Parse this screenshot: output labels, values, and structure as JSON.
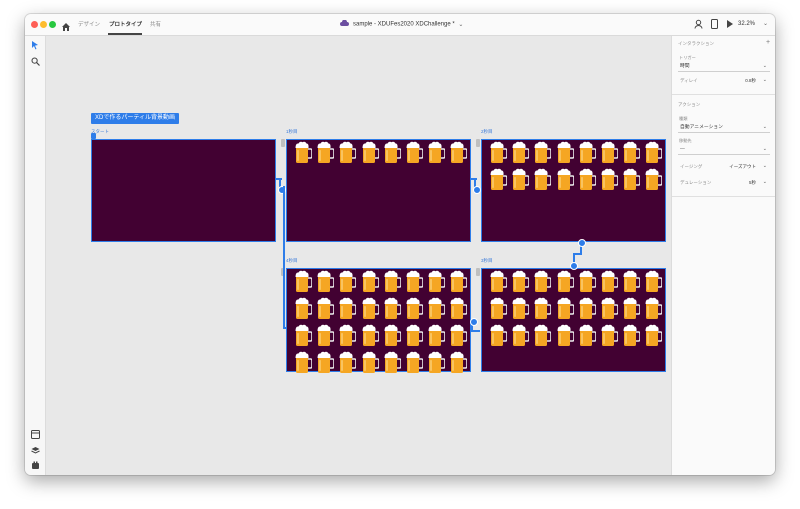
{
  "window": {
    "title": "sample - XDUFes2020 XDChallenge *",
    "mode_tabs": [
      {
        "label": "デザイン",
        "active": false
      },
      {
        "label": "プロトタイプ",
        "active": true
      },
      {
        "label": "共有",
        "active": false
      }
    ],
    "zoom": "32.2%",
    "icons": {
      "home": "home-icon",
      "cloud": "cloud-doc-icon",
      "profile": "profile-icon",
      "device": "mobile-preview-icon",
      "play": "play-icon",
      "chevron": "chevron-down-icon"
    }
  },
  "toolbar": {
    "tools": [
      "select-tool-icon",
      "zoom-tool-icon"
    ],
    "bottom": [
      "assets-icon",
      "layers-icon",
      "plugins-icon"
    ]
  },
  "canvas": {
    "flow_name": "XDで作るパーティル背景動画",
    "artboards": [
      {
        "label": "スタート",
        "beers": 0
      },
      {
        "label": "1秒目",
        "beers": 8
      },
      {
        "label": "2秒目",
        "beers": 16
      },
      {
        "label": "4秒目",
        "beers": 32
      },
      {
        "label": "3秒目",
        "beers": 24
      }
    ],
    "artboard_color": "#420132",
    "accent_color": "#2e7de9"
  },
  "inspector": {
    "interaction_heading": "インタラクション",
    "add_symbol": "+",
    "trigger_label": "トリガー",
    "trigger_value": "時間",
    "delay_label": "ディレイ",
    "delay_value": "0.8秒",
    "action_heading": "アクション",
    "type_label": "種類",
    "type_value": "自動アニメーション",
    "destination_label": "移動先",
    "destination_value": "—",
    "easing_label": "イージング",
    "easing_value": "イーズアウト",
    "duration_label": "デュレーション",
    "duration_value": "5秒"
  }
}
